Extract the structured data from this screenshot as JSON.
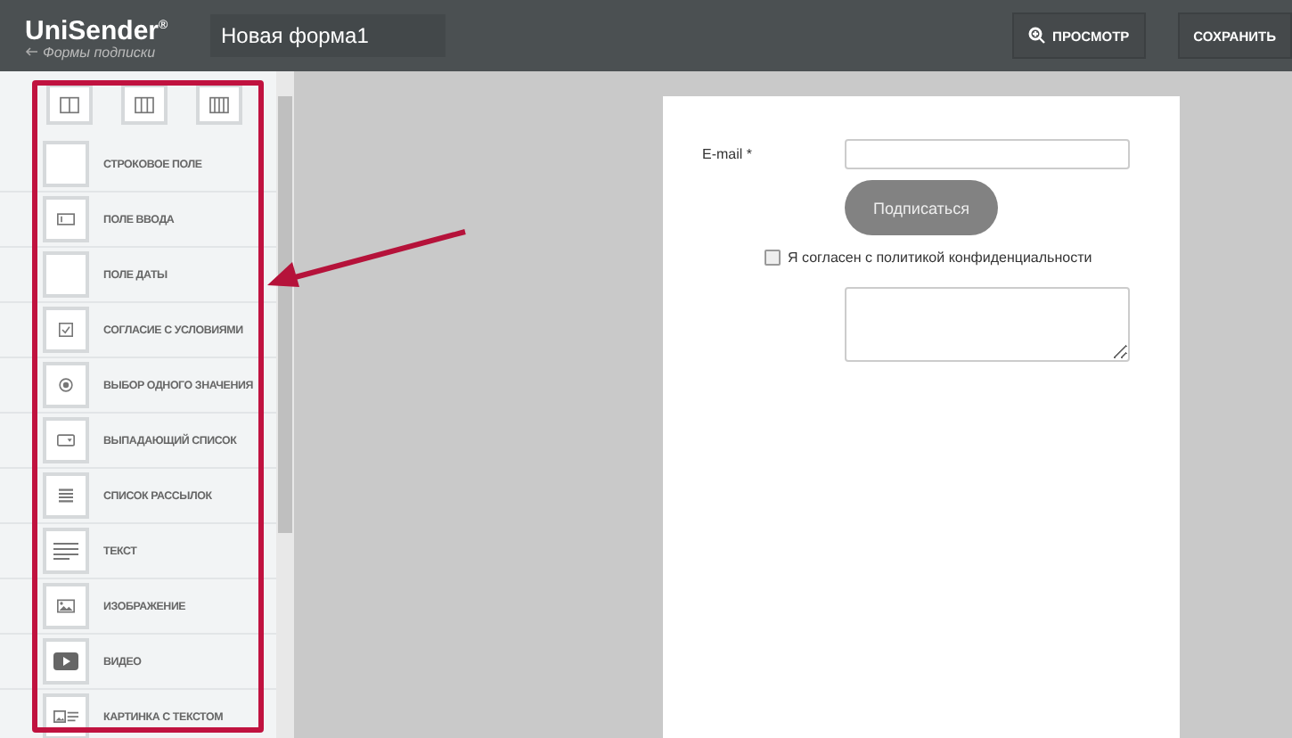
{
  "header": {
    "logo": "UniSender$^{®}$",
    "back_link": "Формы подписки",
    "form_name": "Новая форма1",
    "buttons": [
      {
        "label": "ПРОСМОТР",
        "kind": "preview"
      },
      {
        "label": "СОХРАНИТЬ",
        "kind": "plain"
      }
    ]
  },
  "sidebar": {
    "layouts": [
      {
        "kind": "cols2"
      },
      {
        "kind": "cols3"
      },
      {
        "kind": "cols4"
      }
    ],
    "items": [
      {
        "label": "СТРОКОВОЕ ПОЛЕ",
        "kind": "blank"
      },
      {
        "label": "ПОЛЕ ВВОДА",
        "kind": "input"
      },
      {
        "label": "ПОЛЕ ДАТЫ",
        "kind": "blank"
      },
      {
        "label": "СОГЛАСИЕ С УСЛОВИЯМИ",
        "kind": "checkbox"
      },
      {
        "label": "ВЫБОР ОДНОГО ЗНАЧЕНИЯ",
        "kind": "radio"
      },
      {
        "label": "ВЫПАДАЮЩИЙ СПИСОК",
        "kind": "select"
      },
      {
        "label": "СПИСОК РАССЫЛОК",
        "kind": "list"
      },
      {
        "label": "ТЕКСТ",
        "kind": "text"
      },
      {
        "label": "ИЗОБРАЖЕНИЕ",
        "kind": "image"
      },
      {
        "label": "ВИДЕО",
        "kind": "video"
      },
      {
        "label": "КАРТИНКА С ТЕКСТОМ",
        "kind": "imagetext"
      }
    ]
  },
  "form": {
    "email_label": "E-mail *",
    "submit": "Подписаться",
    "consent": {
      "label": "Я согласен с политикой конфиденциальности",
      "checked": false
    }
  }
}
